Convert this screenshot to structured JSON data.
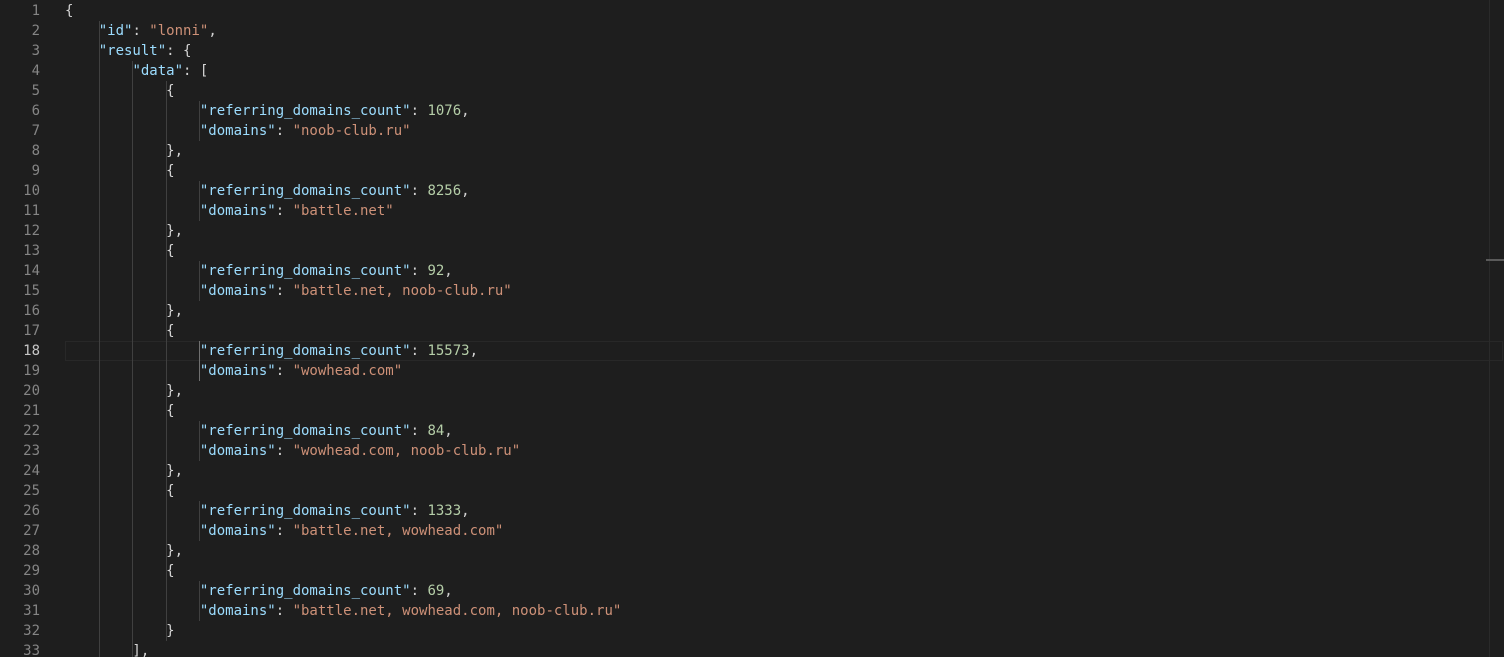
{
  "editor": {
    "active_line": 18,
    "line_numbers": [
      "1",
      "2",
      "3",
      "4",
      "5",
      "6",
      "7",
      "8",
      "9",
      "10",
      "11",
      "12",
      "13",
      "14",
      "15",
      "16",
      "17",
      "18",
      "19",
      "20",
      "21",
      "22",
      "23",
      "24",
      "25",
      "26",
      "27",
      "28",
      "29",
      "30",
      "31",
      "32",
      "33"
    ],
    "id_key": "\"id\"",
    "id_value": "\"lonni\"",
    "result_key": "\"result\"",
    "data_key": "\"data\"",
    "count_key": "\"referring_domains_count\"",
    "domains_key": "\"domains\"",
    "entries": [
      {
        "count": "1076",
        "domains": "\"noob-club.ru\""
      },
      {
        "count": "8256",
        "domains": "\"battle.net\""
      },
      {
        "count": "92",
        "domains": "\"battle.net, noob-club.ru\""
      },
      {
        "count": "15573",
        "domains": "\"wowhead.com\""
      },
      {
        "count": "84",
        "domains": "\"wowhead.com, noob-club.ru\""
      },
      {
        "count": "1333",
        "domains": "\"battle.net, wowhead.com\""
      },
      {
        "count": "69",
        "domains": "\"battle.net, wowhead.com, noob-club.ru\""
      }
    ]
  },
  "colors": {
    "background": "#1e1e1e",
    "key": "#9cdcfe",
    "string": "#ce9178",
    "number": "#b5cea8",
    "punctuation": "#d4d4d4",
    "line_number": "#858585"
  }
}
